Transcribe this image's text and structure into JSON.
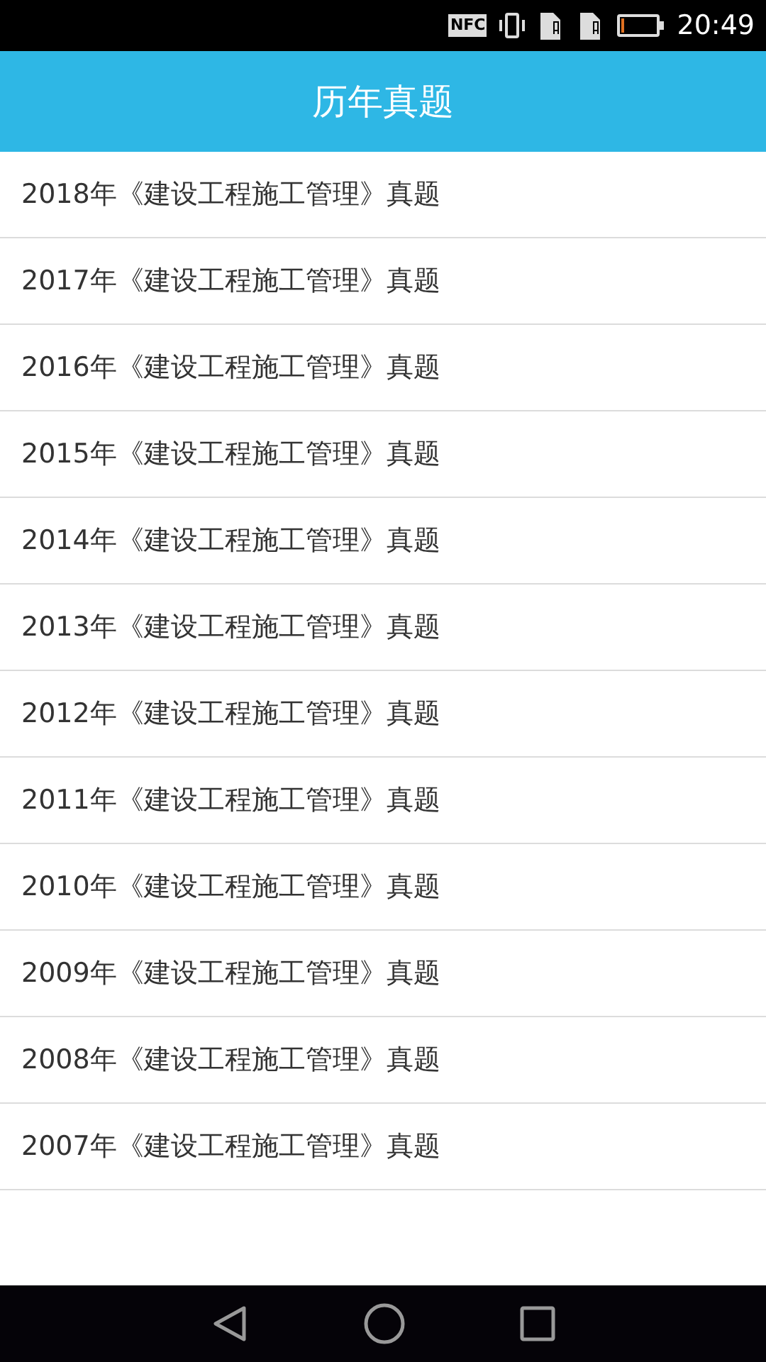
{
  "status_bar": {
    "nfc": "NFC",
    "time": "20:49"
  },
  "header": {
    "title": "历年真题"
  },
  "items": [
    {
      "label": "2018年《建设工程施工管理》真题"
    },
    {
      "label": "2017年《建设工程施工管理》真题"
    },
    {
      "label": "2016年《建设工程施工管理》真题"
    },
    {
      "label": "2015年《建设工程施工管理》真题"
    },
    {
      "label": "2014年《建设工程施工管理》真题"
    },
    {
      "label": "2013年《建设工程施工管理》真题"
    },
    {
      "label": "2012年《建设工程施工管理》真题"
    },
    {
      "label": "2011年《建设工程施工管理》真题"
    },
    {
      "label": "2010年《建设工程施工管理》真题"
    },
    {
      "label": "2009年《建设工程施工管理》真题"
    },
    {
      "label": "2008年《建设工程施工管理》真题"
    },
    {
      "label": "2007年《建设工程施工管理》真题"
    }
  ]
}
